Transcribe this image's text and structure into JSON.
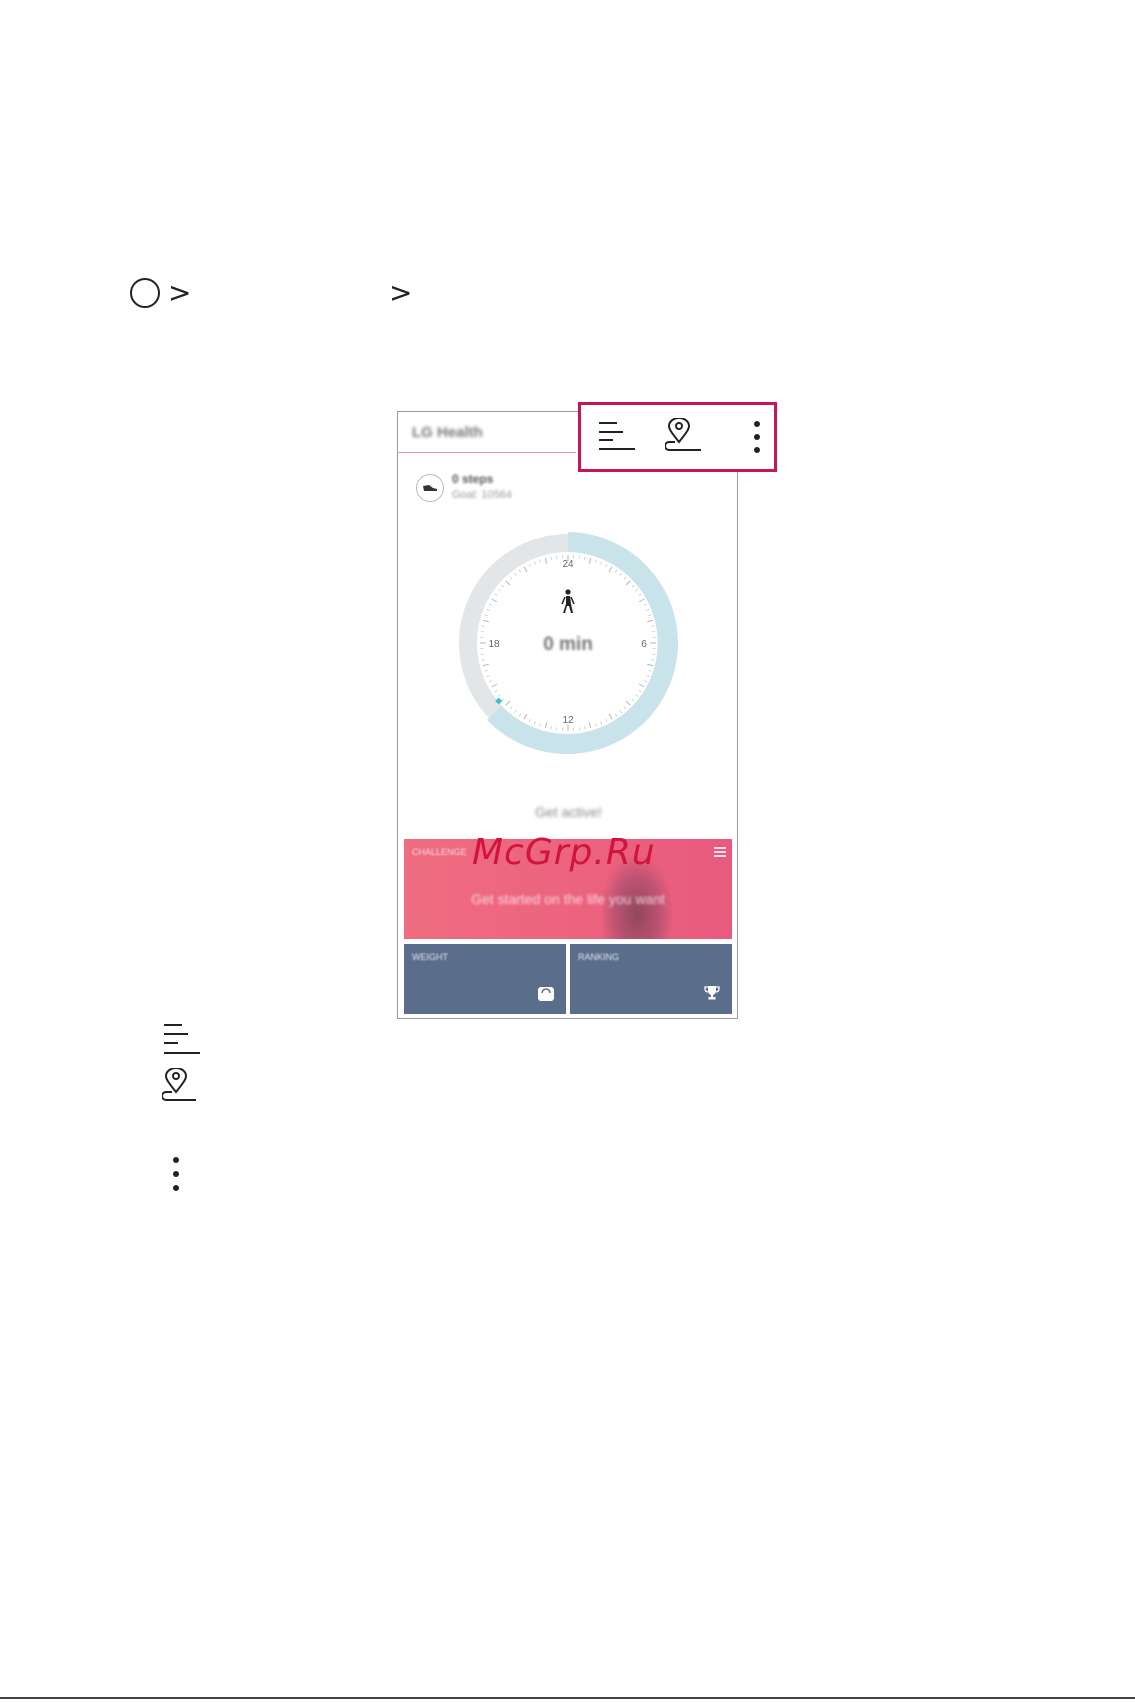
{
  "breadcrumb": {
    "separator": ">"
  },
  "app": {
    "title": "LG Health",
    "steps": {
      "count_label": "0 steps",
      "goal_label": "Goal: 10564"
    },
    "dial": {
      "hour_labels": {
        "top": "24",
        "right": "6",
        "bottom": "12",
        "left": "18"
      },
      "center_value": "0 min"
    },
    "message": "Get active!",
    "challenge": {
      "label": "CHALLENGE",
      "text": "Get started on the life you want"
    },
    "tiles": {
      "weight": "WEIGHT",
      "ranking": "RANKING"
    }
  },
  "toolbar_icons": [
    "list-icon",
    "location-history-icon",
    "more-options-icon"
  ],
  "legend_icons": [
    "list-icon",
    "location-history-icon",
    "more-options-icon"
  ],
  "watermark": "McGrp.Ru",
  "colors": {
    "accent": "#c2185b",
    "challenge": "#ec6480",
    "tile": "#5a6e8c",
    "dial_ring": "#c9e3ea",
    "dial_track": "#e3e6e8"
  }
}
